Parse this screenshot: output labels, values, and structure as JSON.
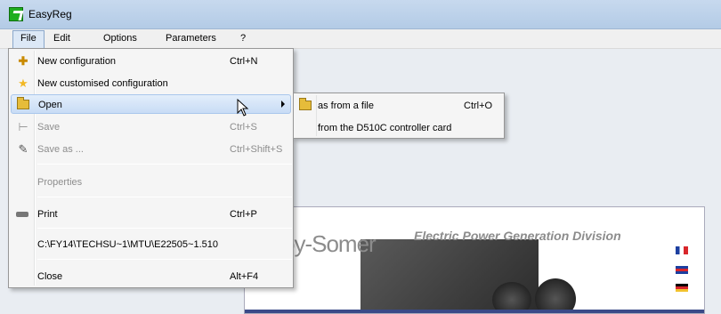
{
  "window": {
    "title": "EasyReg"
  },
  "menubar": {
    "items": [
      "File",
      "Edit",
      "Options",
      "Parameters",
      "?"
    ]
  },
  "file_menu": {
    "new_configuration": {
      "label": "New configuration",
      "shortcut": "Ctrl+N",
      "icon": "new-document-icon"
    },
    "new_custom": {
      "label": "New customised configuration",
      "icon": "star-icon"
    },
    "open": {
      "label": "Open",
      "icon": "open-folder-icon"
    },
    "save": {
      "label": "Save",
      "shortcut": "Ctrl+S",
      "icon": "save-icon"
    },
    "save_as": {
      "label": "Save as ...",
      "shortcut": "Ctrl+Shift+S",
      "icon": "save-as-icon"
    },
    "properties": {
      "label": "Properties"
    },
    "print": {
      "label": "Print",
      "shortcut": "Ctrl+P",
      "icon": "printer-icon"
    },
    "recent": {
      "label": "C:\\FY14\\TECHSU~1\\MTU\\E22505~1.510"
    },
    "close": {
      "label": "Close",
      "shortcut": "Alt+F4"
    }
  },
  "open_submenu": {
    "from_file": {
      "label": "as from a file",
      "shortcut": "Ctrl+O",
      "icon": "open-folder-icon"
    },
    "from_card": {
      "label": "from the D510C controller card"
    }
  },
  "banner": {
    "brand": "oy-Somer",
    "division": "Electric Power Generation Division"
  }
}
